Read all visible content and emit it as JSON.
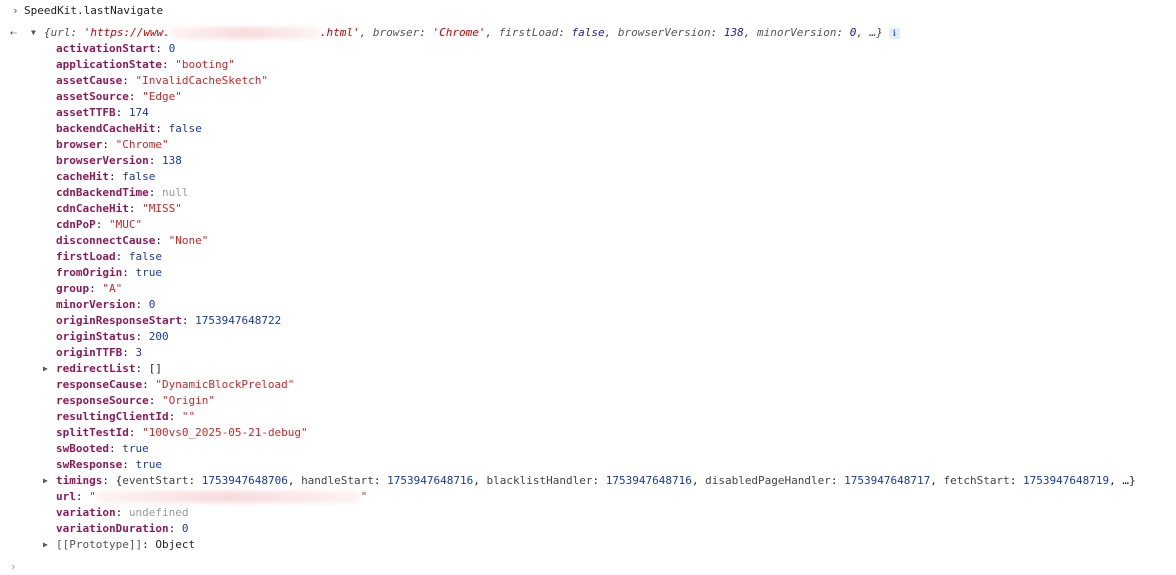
{
  "console": {
    "command": "SpeedKit.lastNavigate",
    "summary": {
      "open": "{",
      "url_key": "url",
      "url_prefix": "'https://www.",
      "url_suffix": ".html'",
      "browser_key": "browser",
      "browser_val": "'Chrome'",
      "firstLoad_key": "firstLoad",
      "firstLoad_val": "false",
      "browserVersion_key": "browserVersion",
      "browserVersion_val": "138",
      "minorVersion_key": "minorVersion",
      "minorVersion_val": "0",
      "tail": "…}",
      "info": "i"
    },
    "props": [
      {
        "key": "activationStart",
        "value": "0",
        "type": "num"
      },
      {
        "key": "applicationState",
        "value": "\"booting\"",
        "type": "str"
      },
      {
        "key": "assetCause",
        "value": "\"InvalidCacheSketch\"",
        "type": "str"
      },
      {
        "key": "assetSource",
        "value": "\"Edge\"",
        "type": "str"
      },
      {
        "key": "assetTTFB",
        "value": "174",
        "type": "num"
      },
      {
        "key": "backendCacheHit",
        "value": "false",
        "type": "bool"
      },
      {
        "key": "browser",
        "value": "\"Chrome\"",
        "type": "str"
      },
      {
        "key": "browserVersion",
        "value": "138",
        "type": "num"
      },
      {
        "key": "cacheHit",
        "value": "false",
        "type": "bool"
      },
      {
        "key": "cdnBackendTime",
        "value": "null",
        "type": "null"
      },
      {
        "key": "cdnCacheHit",
        "value": "\"MISS\"",
        "type": "str"
      },
      {
        "key": "cdnPoP",
        "value": "\"MUC\"",
        "type": "str"
      },
      {
        "key": "disconnectCause",
        "value": "\"None\"",
        "type": "str"
      },
      {
        "key": "firstLoad",
        "value": "false",
        "type": "bool"
      },
      {
        "key": "fromOrigin",
        "value": "true",
        "type": "bool"
      },
      {
        "key": "group",
        "value": "\"A\"",
        "type": "str"
      },
      {
        "key": "minorVersion",
        "value": "0",
        "type": "num"
      },
      {
        "key": "originResponseStart",
        "value": "1753947648722",
        "type": "num"
      },
      {
        "key": "originStatus",
        "value": "200",
        "type": "num"
      },
      {
        "key": "originTTFB",
        "value": "3",
        "type": "num"
      },
      {
        "key": "redirectList",
        "value": "[]",
        "type": "obj",
        "expandable": true
      },
      {
        "key": "responseCause",
        "value": "\"DynamicBlockPreload\"",
        "type": "str"
      },
      {
        "key": "responseSource",
        "value": "\"Origin\"",
        "type": "str"
      },
      {
        "key": "resultingClientId",
        "value": "\"\"",
        "type": "str"
      },
      {
        "key": "splitTestId",
        "value": "\"100vs0_2025-05-21-debug\"",
        "type": "str"
      },
      {
        "key": "swBooted",
        "value": "true",
        "type": "bool"
      },
      {
        "key": "swResponse",
        "value": "true",
        "type": "bool"
      },
      {
        "key": "timings",
        "type": "timings",
        "expandable": true,
        "value": "{eventStart: 1753947648706, handleStart: 1753947648716, blacklistHandler: 1753947648716, disabledPageHandler: 1753947648717, fetchStart: 1753947648719, …}"
      },
      {
        "key": "url",
        "type": "url",
        "value_open": "\"",
        "value_close": "\""
      },
      {
        "key": "variation",
        "value": "undefined",
        "type": "undef"
      },
      {
        "key": "variationDuration",
        "value": "0",
        "type": "num"
      },
      {
        "key": "[[Prototype]]",
        "value": "Object",
        "type": "obj",
        "expandable": true,
        "proto": true
      }
    ]
  }
}
